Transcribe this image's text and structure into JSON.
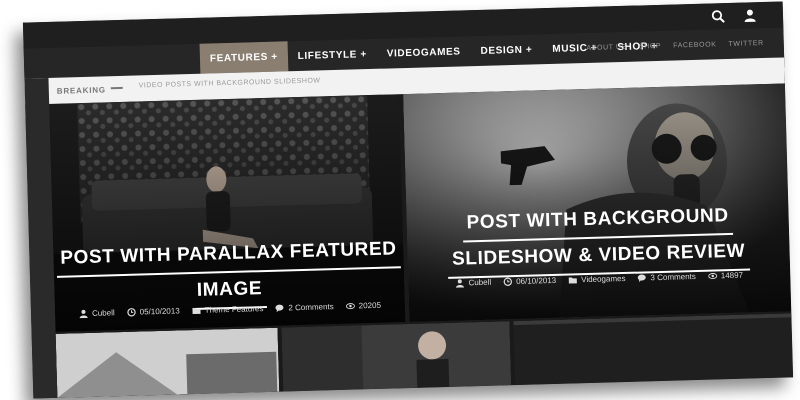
{
  "header": {
    "search_icon": "search-icon",
    "user_icon": "user-icon"
  },
  "nav": {
    "items": [
      {
        "label": "FEATURES +",
        "active": true
      },
      {
        "label": "LIFESTYLE +",
        "active": false
      },
      {
        "label": "VIDEOGAMES",
        "active": false
      },
      {
        "label": "DESIGN +",
        "active": false
      },
      {
        "label": "MUSIC +",
        "active": false
      },
      {
        "label": "SHOP +",
        "active": false
      }
    ],
    "right_links": [
      "ABOUT US",
      "SHOP",
      "FACEBOOK",
      "TWITTER"
    ],
    "active_color": "#8a7e70"
  },
  "breaking": {
    "label": "BREAKING",
    "ticker": "VIDEO POSTS WITH BACKGROUND SLIDESHOW"
  },
  "posts": [
    {
      "title_line1": "POST WITH PARALLAX FEATURED",
      "title_line2": "IMAGE",
      "author": "Cubell",
      "date": "05/10/2013",
      "category": "Theme Features",
      "comments": "2 Comments",
      "views": "20205"
    },
    {
      "title_line1": "POST WITH BACKGROUND",
      "title_line2": "SLIDESHOW & VIDEO REVIEW",
      "author": "Cubell",
      "date": "06/10/2013",
      "category": "Videogames",
      "comments": "3 Comments",
      "views": "14897"
    }
  ]
}
